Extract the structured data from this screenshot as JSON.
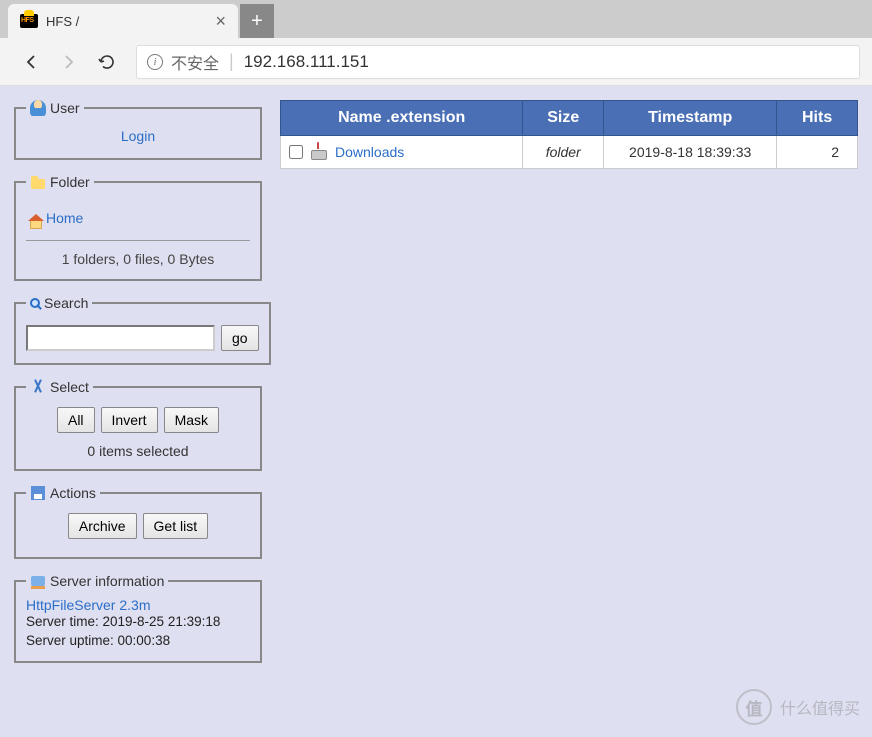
{
  "browser": {
    "tab_title": "HFS /",
    "address_warn": "不安全",
    "address_url": "192.168.111.151"
  },
  "sidebar": {
    "user": {
      "legend": "User",
      "login": "Login"
    },
    "folder": {
      "legend": "Folder",
      "home": "Home",
      "stats": "1 folders, 0 files, 0 Bytes"
    },
    "search": {
      "legend": "Search",
      "go": "go"
    },
    "select": {
      "legend": "Select",
      "all": "All",
      "invert": "Invert",
      "mask": "Mask",
      "status": "0 items selected"
    },
    "actions": {
      "legend": "Actions",
      "archive": "Archive",
      "getlist": "Get list"
    },
    "server": {
      "legend": "Server information",
      "link": "HttpFileServer 2.3m",
      "time": "Server time: 2019-8-25 21:39:18",
      "uptime": "Server uptime: 00:00:38"
    }
  },
  "table": {
    "headers": {
      "name": "Name .extension",
      "size": "Size",
      "timestamp": "Timestamp",
      "hits": "Hits"
    },
    "rows": [
      {
        "name": "Downloads",
        "size": "folder",
        "timestamp": "2019-8-18 18:39:33",
        "hits": "2"
      }
    ]
  },
  "watermark": {
    "icon": "值",
    "text": "什么值得买"
  }
}
